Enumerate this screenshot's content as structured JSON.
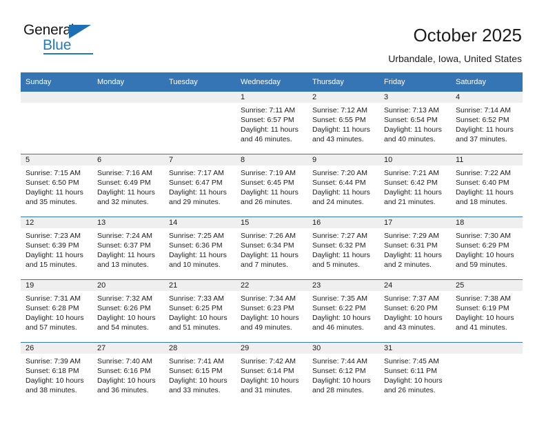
{
  "brand": {
    "name_top": "General",
    "name_bottom": "Blue",
    "accent_color": "#1f7ac4",
    "triangle_color": "#1f6fb5"
  },
  "header": {
    "title": "October 2025",
    "location": "Urbandale, Iowa, United States"
  },
  "calendar": {
    "header_bg": "#3575b5",
    "daynum_bg": "#efefef",
    "weekday_headers": [
      "Sunday",
      "Monday",
      "Tuesday",
      "Wednesday",
      "Thursday",
      "Friday",
      "Saturday"
    ],
    "labels": {
      "sunrise_prefix": "Sunrise:",
      "sunset_prefix": "Sunset:",
      "daylight_prefix": "Daylight:"
    },
    "weeks": [
      [
        {
          "day": "",
          "sunrise": "",
          "sunset": "",
          "daylight_line1": "",
          "daylight_line2": ""
        },
        {
          "day": "",
          "sunrise": "",
          "sunset": "",
          "daylight_line1": "",
          "daylight_line2": ""
        },
        {
          "day": "",
          "sunrise": "",
          "sunset": "",
          "daylight_line1": "",
          "daylight_line2": ""
        },
        {
          "day": "1",
          "sunrise": "Sunrise: 7:11 AM",
          "sunset": "Sunset: 6:57 PM",
          "daylight_line1": "Daylight: 11 hours",
          "daylight_line2": "and 46 minutes."
        },
        {
          "day": "2",
          "sunrise": "Sunrise: 7:12 AM",
          "sunset": "Sunset: 6:55 PM",
          "daylight_line1": "Daylight: 11 hours",
          "daylight_line2": "and 43 minutes."
        },
        {
          "day": "3",
          "sunrise": "Sunrise: 7:13 AM",
          "sunset": "Sunset: 6:54 PM",
          "daylight_line1": "Daylight: 11 hours",
          "daylight_line2": "and 40 minutes."
        },
        {
          "day": "4",
          "sunrise": "Sunrise: 7:14 AM",
          "sunset": "Sunset: 6:52 PM",
          "daylight_line1": "Daylight: 11 hours",
          "daylight_line2": "and 37 minutes."
        }
      ],
      [
        {
          "day": "5",
          "sunrise": "Sunrise: 7:15 AM",
          "sunset": "Sunset: 6:50 PM",
          "daylight_line1": "Daylight: 11 hours",
          "daylight_line2": "and 35 minutes."
        },
        {
          "day": "6",
          "sunrise": "Sunrise: 7:16 AM",
          "sunset": "Sunset: 6:49 PM",
          "daylight_line1": "Daylight: 11 hours",
          "daylight_line2": "and 32 minutes."
        },
        {
          "day": "7",
          "sunrise": "Sunrise: 7:17 AM",
          "sunset": "Sunset: 6:47 PM",
          "daylight_line1": "Daylight: 11 hours",
          "daylight_line2": "and 29 minutes."
        },
        {
          "day": "8",
          "sunrise": "Sunrise: 7:19 AM",
          "sunset": "Sunset: 6:45 PM",
          "daylight_line1": "Daylight: 11 hours",
          "daylight_line2": "and 26 minutes."
        },
        {
          "day": "9",
          "sunrise": "Sunrise: 7:20 AM",
          "sunset": "Sunset: 6:44 PM",
          "daylight_line1": "Daylight: 11 hours",
          "daylight_line2": "and 24 minutes."
        },
        {
          "day": "10",
          "sunrise": "Sunrise: 7:21 AM",
          "sunset": "Sunset: 6:42 PM",
          "daylight_line1": "Daylight: 11 hours",
          "daylight_line2": "and 21 minutes."
        },
        {
          "day": "11",
          "sunrise": "Sunrise: 7:22 AM",
          "sunset": "Sunset: 6:40 PM",
          "daylight_line1": "Daylight: 11 hours",
          "daylight_line2": "and 18 minutes."
        }
      ],
      [
        {
          "day": "12",
          "sunrise": "Sunrise: 7:23 AM",
          "sunset": "Sunset: 6:39 PM",
          "daylight_line1": "Daylight: 11 hours",
          "daylight_line2": "and 15 minutes."
        },
        {
          "day": "13",
          "sunrise": "Sunrise: 7:24 AM",
          "sunset": "Sunset: 6:37 PM",
          "daylight_line1": "Daylight: 11 hours",
          "daylight_line2": "and 13 minutes."
        },
        {
          "day": "14",
          "sunrise": "Sunrise: 7:25 AM",
          "sunset": "Sunset: 6:36 PM",
          "daylight_line1": "Daylight: 11 hours",
          "daylight_line2": "and 10 minutes."
        },
        {
          "day": "15",
          "sunrise": "Sunrise: 7:26 AM",
          "sunset": "Sunset: 6:34 PM",
          "daylight_line1": "Daylight: 11 hours",
          "daylight_line2": "and 7 minutes."
        },
        {
          "day": "16",
          "sunrise": "Sunrise: 7:27 AM",
          "sunset": "Sunset: 6:32 PM",
          "daylight_line1": "Daylight: 11 hours",
          "daylight_line2": "and 5 minutes."
        },
        {
          "day": "17",
          "sunrise": "Sunrise: 7:29 AM",
          "sunset": "Sunset: 6:31 PM",
          "daylight_line1": "Daylight: 11 hours",
          "daylight_line2": "and 2 minutes."
        },
        {
          "day": "18",
          "sunrise": "Sunrise: 7:30 AM",
          "sunset": "Sunset: 6:29 PM",
          "daylight_line1": "Daylight: 10 hours",
          "daylight_line2": "and 59 minutes."
        }
      ],
      [
        {
          "day": "19",
          "sunrise": "Sunrise: 7:31 AM",
          "sunset": "Sunset: 6:28 PM",
          "daylight_line1": "Daylight: 10 hours",
          "daylight_line2": "and 57 minutes."
        },
        {
          "day": "20",
          "sunrise": "Sunrise: 7:32 AM",
          "sunset": "Sunset: 6:26 PM",
          "daylight_line1": "Daylight: 10 hours",
          "daylight_line2": "and 54 minutes."
        },
        {
          "day": "21",
          "sunrise": "Sunrise: 7:33 AM",
          "sunset": "Sunset: 6:25 PM",
          "daylight_line1": "Daylight: 10 hours",
          "daylight_line2": "and 51 minutes."
        },
        {
          "day": "22",
          "sunrise": "Sunrise: 7:34 AM",
          "sunset": "Sunset: 6:23 PM",
          "daylight_line1": "Daylight: 10 hours",
          "daylight_line2": "and 49 minutes."
        },
        {
          "day": "23",
          "sunrise": "Sunrise: 7:35 AM",
          "sunset": "Sunset: 6:22 PM",
          "daylight_line1": "Daylight: 10 hours",
          "daylight_line2": "and 46 minutes."
        },
        {
          "day": "24",
          "sunrise": "Sunrise: 7:37 AM",
          "sunset": "Sunset: 6:20 PM",
          "daylight_line1": "Daylight: 10 hours",
          "daylight_line2": "and 43 minutes."
        },
        {
          "day": "25",
          "sunrise": "Sunrise: 7:38 AM",
          "sunset": "Sunset: 6:19 PM",
          "daylight_line1": "Daylight: 10 hours",
          "daylight_line2": "and 41 minutes."
        }
      ],
      [
        {
          "day": "26",
          "sunrise": "Sunrise: 7:39 AM",
          "sunset": "Sunset: 6:18 PM",
          "daylight_line1": "Daylight: 10 hours",
          "daylight_line2": "and 38 minutes."
        },
        {
          "day": "27",
          "sunrise": "Sunrise: 7:40 AM",
          "sunset": "Sunset: 6:16 PM",
          "daylight_line1": "Daylight: 10 hours",
          "daylight_line2": "and 36 minutes."
        },
        {
          "day": "28",
          "sunrise": "Sunrise: 7:41 AM",
          "sunset": "Sunset: 6:15 PM",
          "daylight_line1": "Daylight: 10 hours",
          "daylight_line2": "and 33 minutes."
        },
        {
          "day": "29",
          "sunrise": "Sunrise: 7:42 AM",
          "sunset": "Sunset: 6:14 PM",
          "daylight_line1": "Daylight: 10 hours",
          "daylight_line2": "and 31 minutes."
        },
        {
          "day": "30",
          "sunrise": "Sunrise: 7:44 AM",
          "sunset": "Sunset: 6:12 PM",
          "daylight_line1": "Daylight: 10 hours",
          "daylight_line2": "and 28 minutes."
        },
        {
          "day": "31",
          "sunrise": "Sunrise: 7:45 AM",
          "sunset": "Sunset: 6:11 PM",
          "daylight_line1": "Daylight: 10 hours",
          "daylight_line2": "and 26 minutes."
        },
        {
          "day": "",
          "sunrise": "",
          "sunset": "",
          "daylight_line1": "",
          "daylight_line2": ""
        }
      ]
    ]
  }
}
